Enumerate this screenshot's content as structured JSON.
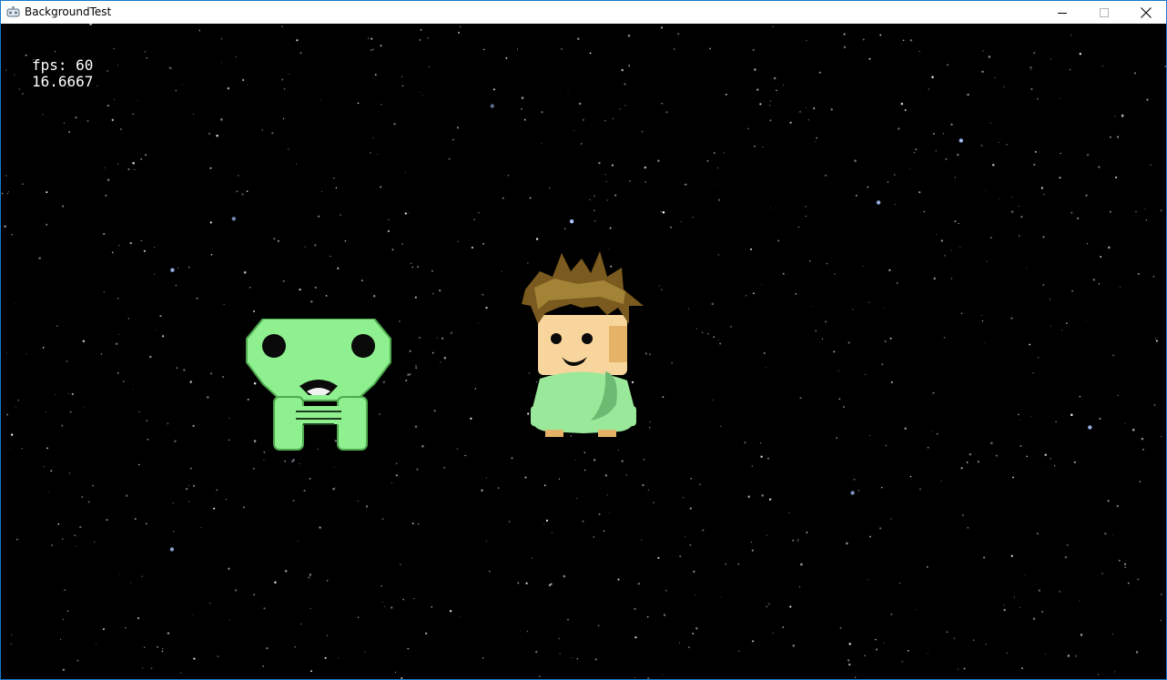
{
  "window": {
    "title": "BackgroundTest",
    "controls": {
      "minimize": "minimize-icon",
      "maximize": "maximize-icon",
      "close": "close-icon"
    }
  },
  "hud": {
    "fps_text": "fps: 60",
    "frame_time": "16.6667"
  },
  "scene": {
    "background": "starfield",
    "sprites": [
      {
        "name": "green-alien",
        "color": "#8ef08e"
      },
      {
        "name": "boy-green-shirt",
        "color": "#9ae89a"
      }
    ]
  },
  "colors": {
    "border": "#1979ca",
    "space": "#000000",
    "alien_body": "#8ef08e",
    "shirt": "#9ae89a",
    "hair": "#7a5a1e",
    "skin": "#f8d59c"
  }
}
